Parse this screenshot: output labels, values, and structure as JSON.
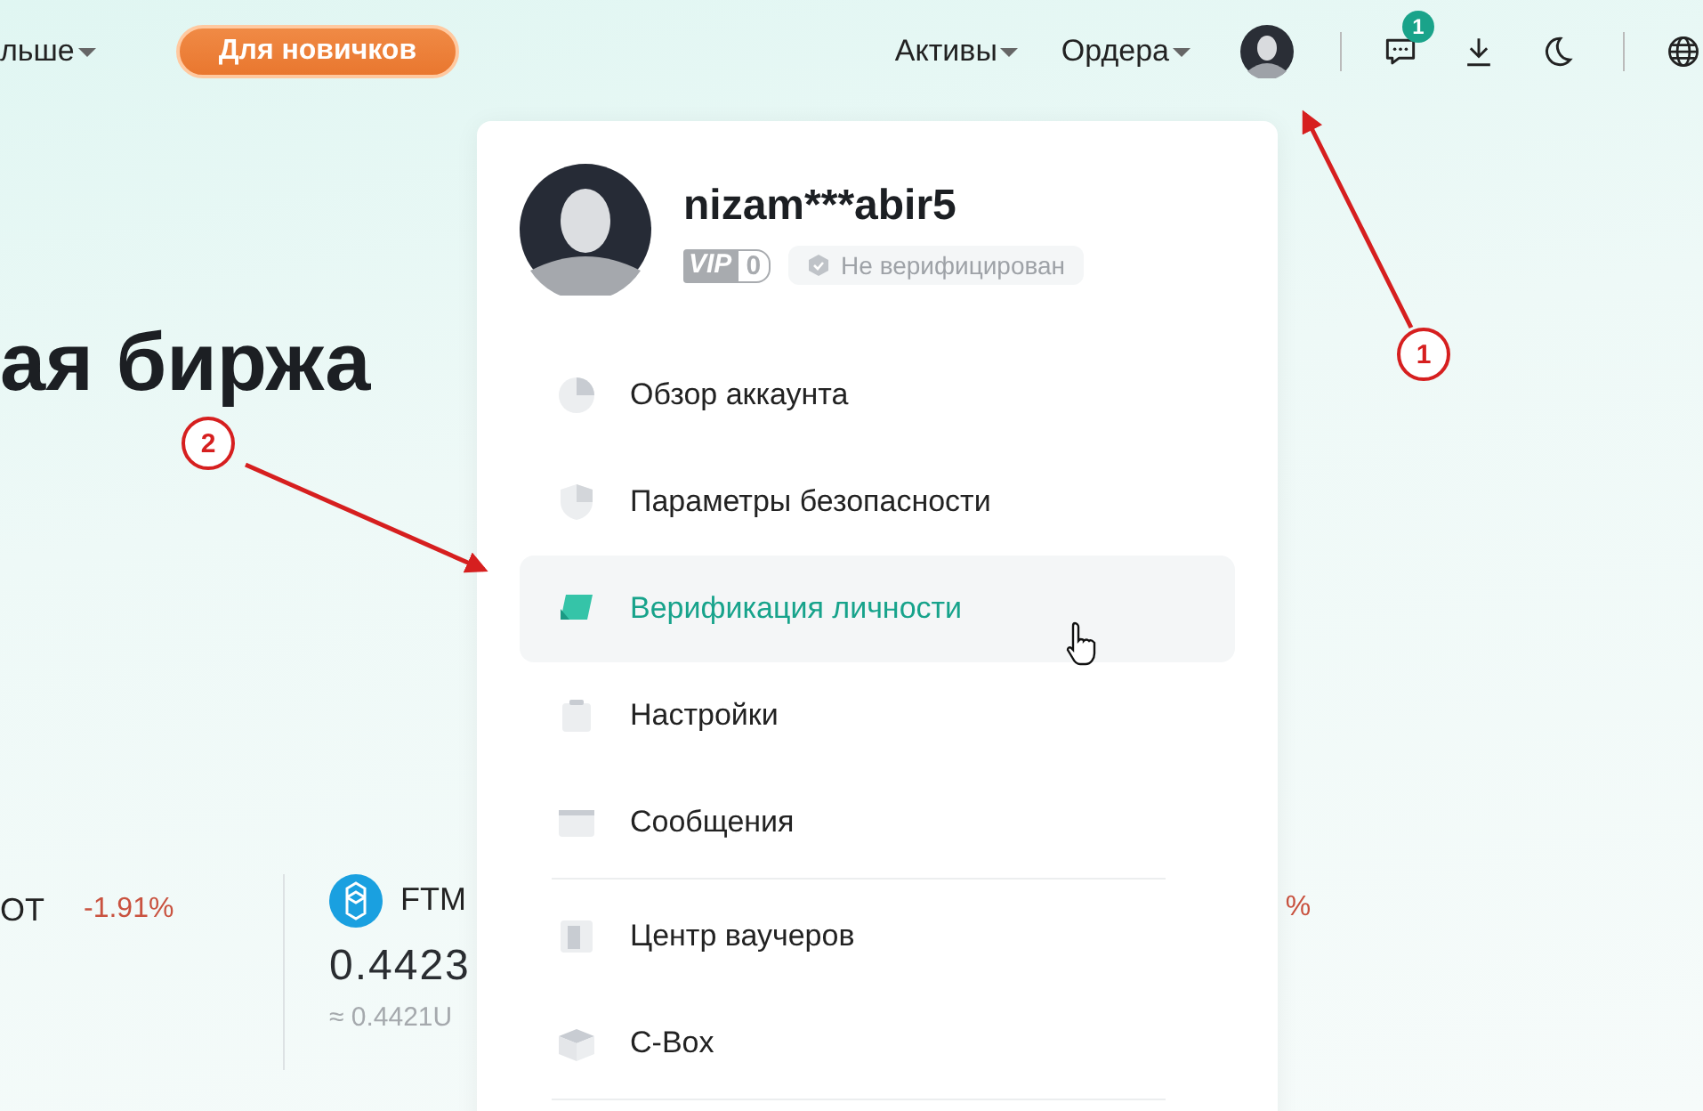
{
  "header": {
    "more_menu": "льше",
    "newcomer_button": "Для новичков",
    "nav": [
      {
        "label": "Активы"
      },
      {
        "label": "Ордера"
      }
    ],
    "messages_badge": "1"
  },
  "hero": {
    "title": "ая биржа"
  },
  "tickers": {
    "first": {
      "symbol": "OT",
      "change": "-1.91%"
    },
    "second": {
      "symbol": "FTM",
      "price": "0.4423",
      "approx": "≈ 0.4421U"
    },
    "third": {
      "change": "%"
    }
  },
  "account_menu": {
    "username": "nizam***abir5",
    "vip": "VIP",
    "vip_level": "0",
    "verification": "Не верифицирован",
    "sections": [
      {
        "items": [
          {
            "label": "Обзор аккаунта",
            "selected": false
          },
          {
            "label": "Параметры безопасности",
            "selected": false
          },
          {
            "label": "Верификация личности",
            "selected": true
          },
          {
            "label": "Настройки",
            "selected": false
          },
          {
            "label": "Сообщения",
            "selected": false
          }
        ]
      },
      {
        "items": [
          {
            "label": "Центр ваучеров",
            "selected": false
          },
          {
            "label": "C-Box",
            "selected": false
          }
        ]
      }
    ]
  },
  "annotations": [
    {
      "number": "1"
    },
    {
      "number": "2"
    }
  ]
}
